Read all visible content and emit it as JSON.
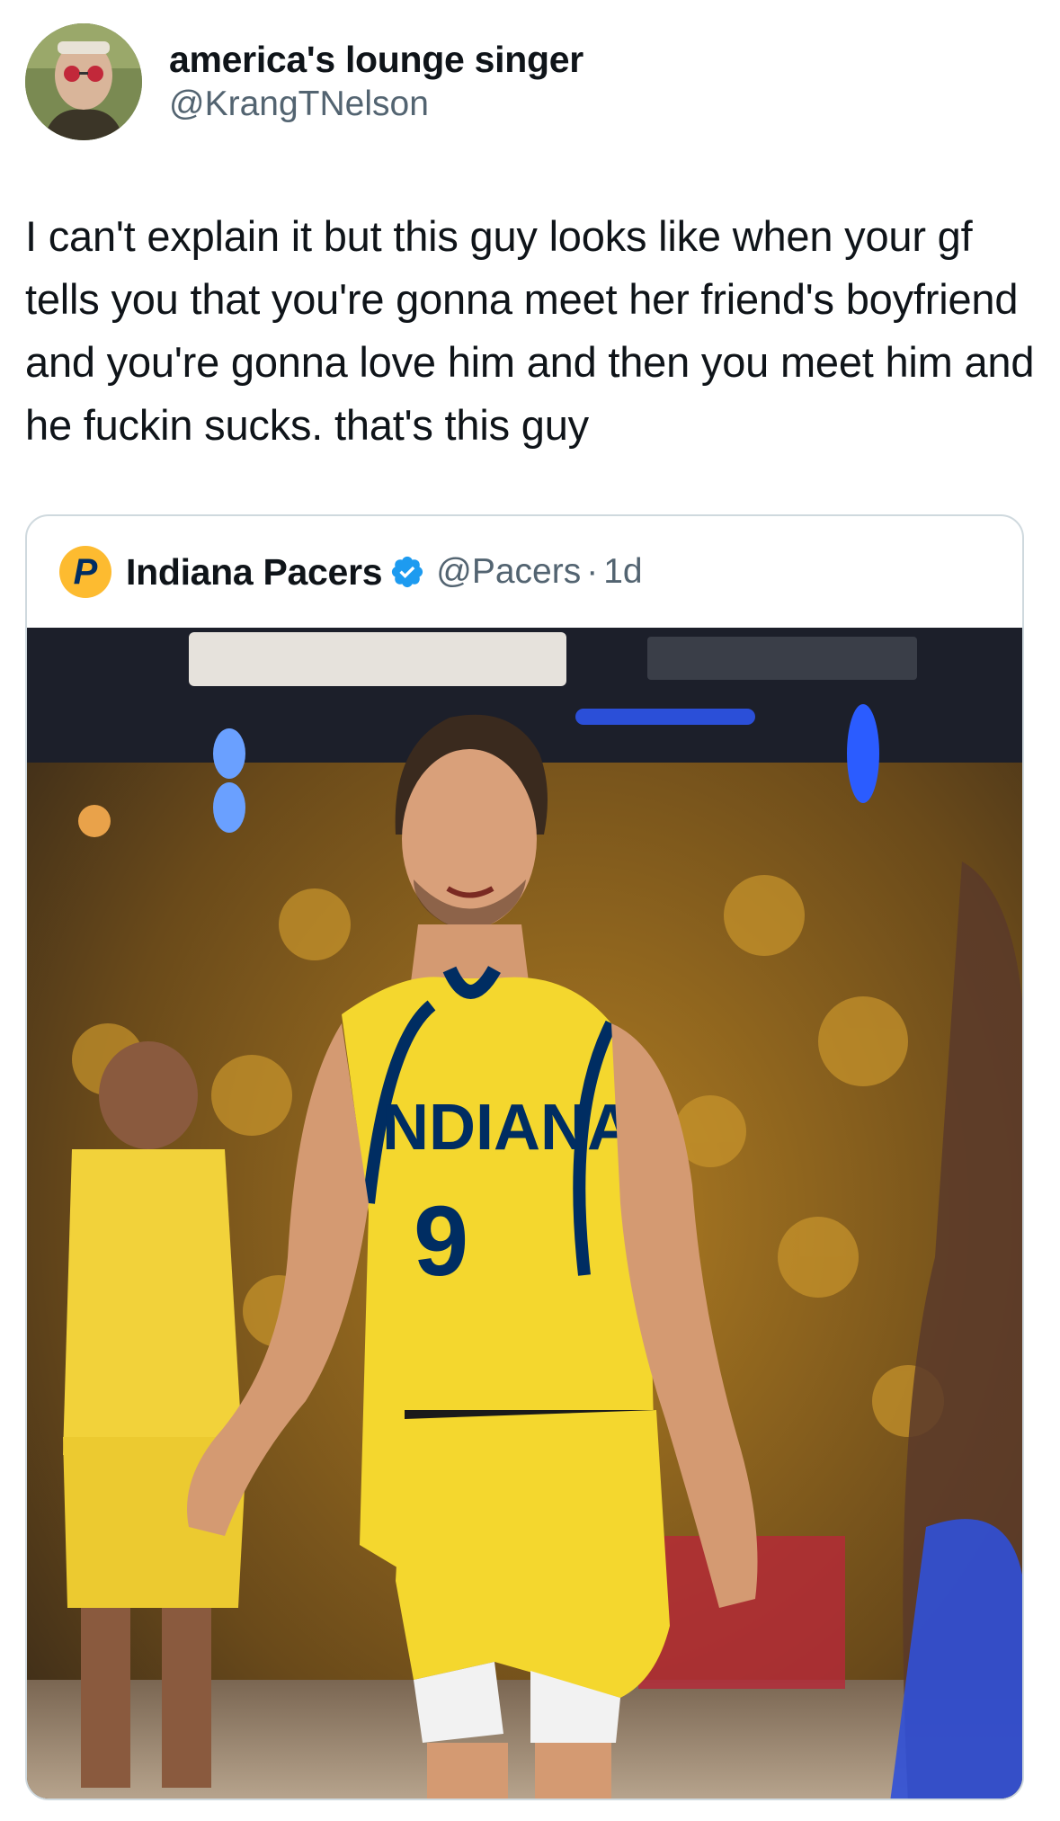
{
  "tweet": {
    "author_name": "america's lounge singer",
    "author_handle": "@KrangTNelson",
    "text": "I can't explain it but this guy looks like when your gf tells you that you're gonna meet her friend's boyfriend and you're gonna love him and then you meet him and he fuckin sucks. that's this guy"
  },
  "quote": {
    "name": "Indiana Pacers",
    "handle": "@Pacers",
    "separator": "·",
    "time": "1d",
    "logo_letter": "P",
    "verified_icon": "verified-badge-icon",
    "photo": {
      "jersey_wordmark": "NDIANA",
      "jersey_number": "9"
    }
  },
  "colors": {
    "text_primary": "#0f1419",
    "text_secondary": "#536471",
    "border": "#cfd9de",
    "verified_blue": "#1d9bf0",
    "pacers_gold": "#fdbb30",
    "pacers_navy": "#002d62"
  }
}
